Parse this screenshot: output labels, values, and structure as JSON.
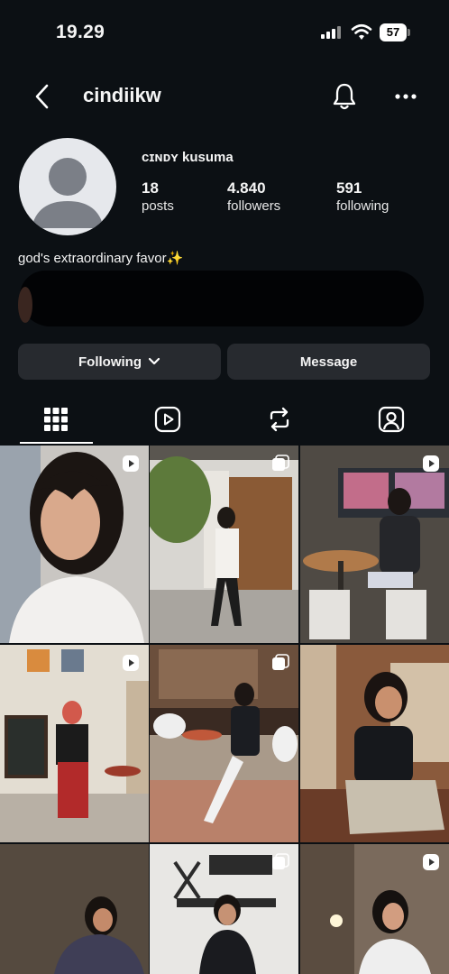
{
  "status_bar": {
    "time": "19.29",
    "battery": "57"
  },
  "header": {
    "username": "cindiikw"
  },
  "profile": {
    "full_name": "ᴄɪɴᴅʏ kusuma",
    "stats": [
      {
        "value": "18",
        "label": "posts"
      },
      {
        "value": "4.840",
        "label": "followers"
      },
      {
        "value": "591",
        "label": "following"
      }
    ],
    "bio": "god's extraordinary favor✨"
  },
  "actions": {
    "following_label": "Following",
    "message_label": "Message"
  },
  "tabs": [
    "grid-icon",
    "reels-icon",
    "reposts-icon",
    "tagged-icon"
  ],
  "grid": [
    {
      "type": "reel",
      "scene": "portrait"
    },
    {
      "type": "carousel",
      "scene": "street"
    },
    {
      "type": "reel",
      "scene": "cafe"
    },
    {
      "type": "reel",
      "scene": "room"
    },
    {
      "type": "carousel",
      "scene": "coffee-shop"
    },
    {
      "type": "none",
      "scene": "brick-wall"
    },
    {
      "type": "none",
      "scene": "dark-room"
    },
    {
      "type": "carousel",
      "scene": "clock-mural"
    },
    {
      "type": "reel",
      "scene": "lamp-room"
    }
  ],
  "colors": {
    "background": "#0c1014",
    "button": "#272a2f",
    "text": "#f5f5f5"
  }
}
